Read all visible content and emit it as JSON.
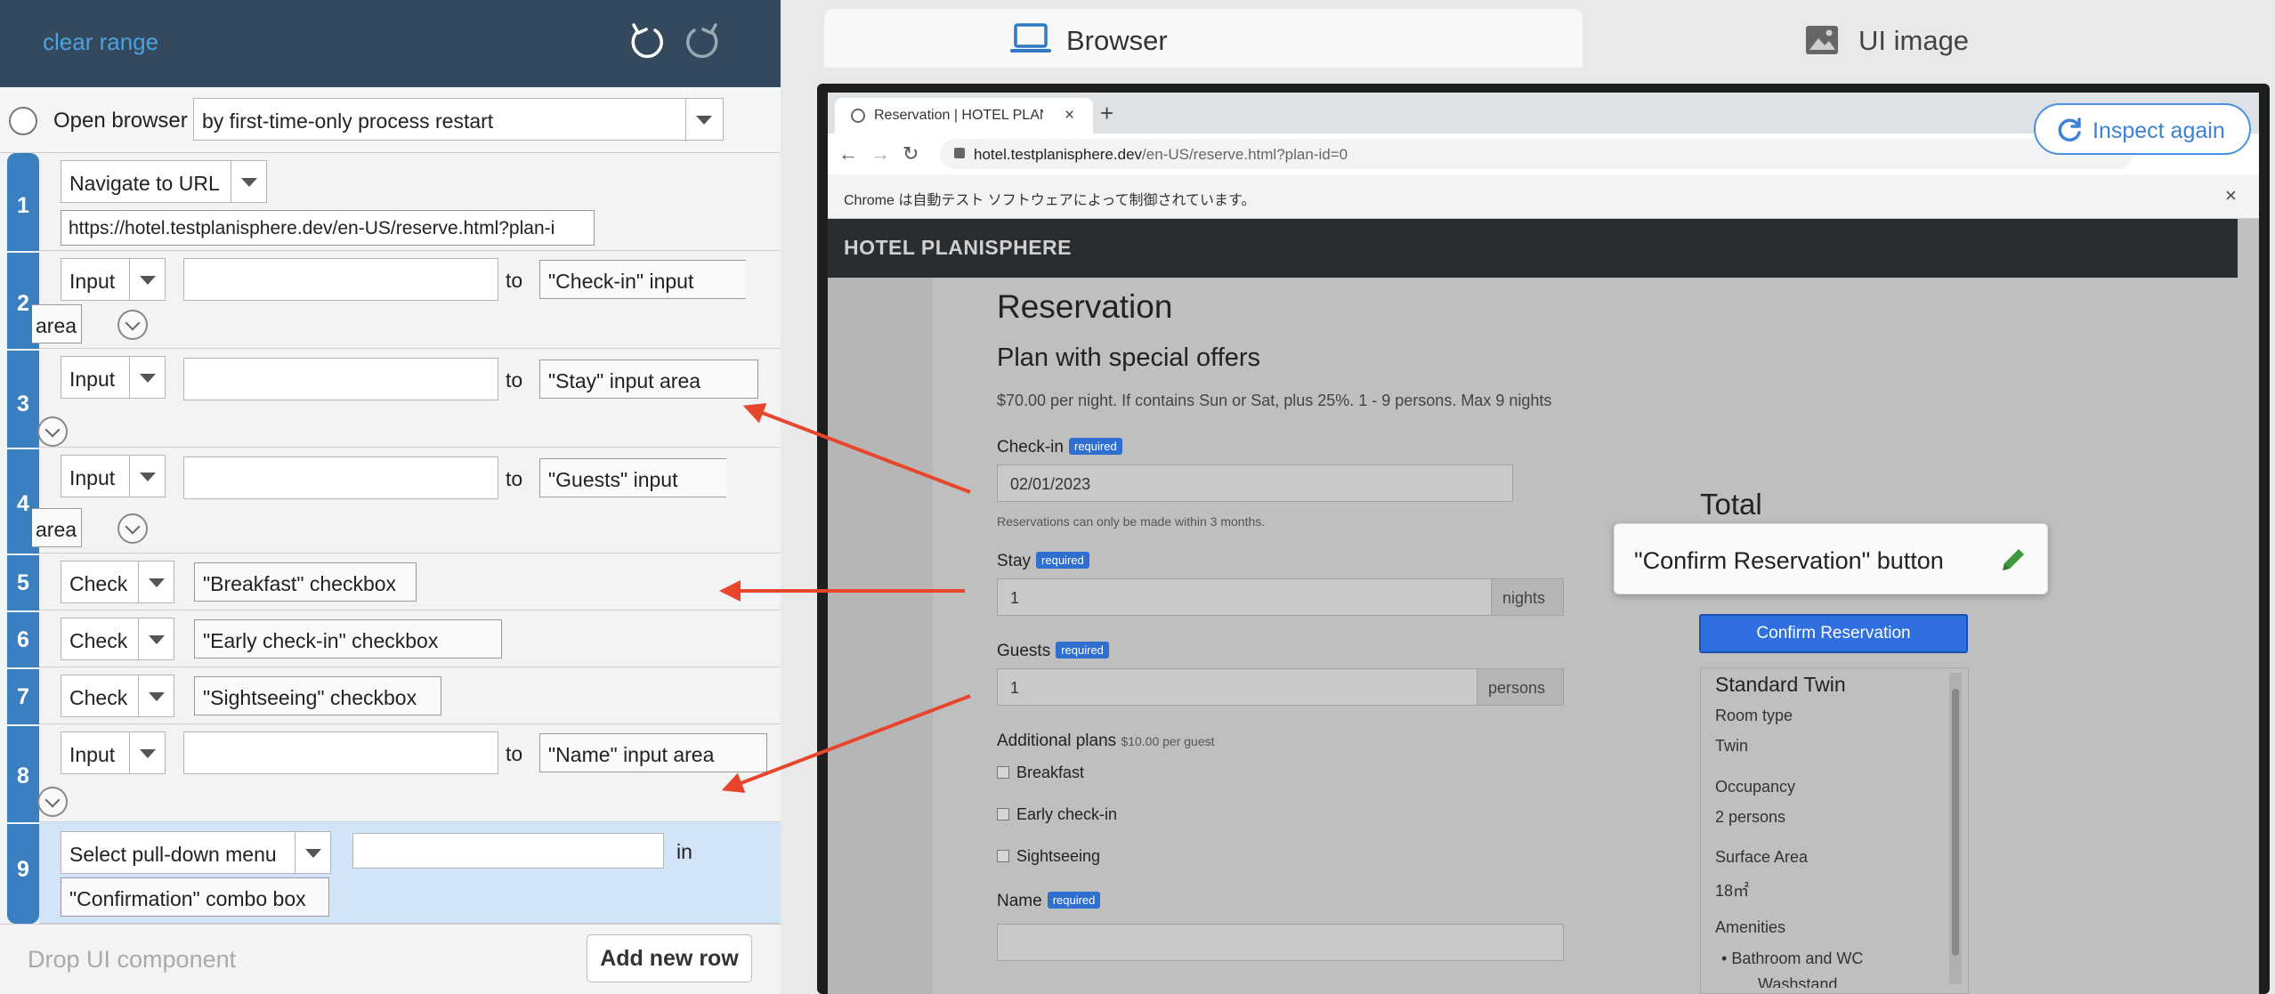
{
  "left_panel": {
    "clear_range": "clear range",
    "open_browser": {
      "label": "Open browser",
      "mode": "by first-time-only process restart"
    },
    "steps": [
      {
        "num": "1",
        "action": "Navigate to URL",
        "url": "https://hotel.testplanisphere.dev/en-US/reserve.html?plan-i"
      },
      {
        "num": "2",
        "action": "Input",
        "connector": "to",
        "target": "\"Check-in\" input",
        "target_wrap": "area"
      },
      {
        "num": "3",
        "action": "Input",
        "connector": "to",
        "target": "\"Stay\" input area"
      },
      {
        "num": "4",
        "action": "Input",
        "connector": "to",
        "target": "\"Guests\" input",
        "target_wrap": "area"
      },
      {
        "num": "5",
        "action": "Check",
        "target": "\"Breakfast\" checkbox"
      },
      {
        "num": "6",
        "action": "Check",
        "target": "\"Early check-in\" checkbox"
      },
      {
        "num": "7",
        "action": "Check",
        "target": "\"Sightseeing\" checkbox"
      },
      {
        "num": "8",
        "action": "Input",
        "connector": "to",
        "target": "\"Name\" input area"
      },
      {
        "num": "9",
        "action": "Select pull-down menu",
        "connector": "in",
        "target": "\"Confirmation\" combo box"
      }
    ],
    "drop_ui": "Drop UI component",
    "add_row": "Add new row"
  },
  "right_panel": {
    "tabs": {
      "browser": "Browser",
      "ui_image": "UI image"
    },
    "inspect_again": "Inspect again",
    "chrome": {
      "tab_title": "Reservation | HOTEL PLANIS",
      "url_host": "hotel.testplanisphere.dev",
      "url_path": "/en-US/reserve.html?plan-id=0",
      "infobar": "Chrome は自動テスト ソフトウェアによって制御されています。"
    },
    "page": {
      "brand": "HOTEL PLANISPHERE",
      "title": "Reservation",
      "plan": "Plan with special offers",
      "desc": "$70.00 per night. If contains Sun or Sat, plus 25%. 1 - 9 persons. Max 9 nights",
      "required": "required",
      "checkin_label": "Check-in",
      "checkin_value": "02/01/2023",
      "checkin_hint": "Reservations can only be made within 3 months.",
      "stay_label": "Stay",
      "stay_value": "1",
      "stay_unit": "nights",
      "guests_label": "Guests",
      "guests_value": "1",
      "guests_unit": "persons",
      "additional_label": "Additional plans",
      "additional_note": "$10.00 per guest",
      "plans": [
        "Breakfast",
        "Early check-in",
        "Sightseeing"
      ],
      "name_label": "Name",
      "total": "Total",
      "confirm": "Confirm Reservation",
      "room": {
        "title": "Standard Twin",
        "room_type_label": "Room type",
        "room_type": "Twin",
        "occupancy_label": "Occupancy",
        "occupancy": "2 persons",
        "area_label": "Surface Area",
        "area": "18㎡",
        "amenities_label": "Amenities",
        "amenity_1": "Bathroom and WC",
        "amenity_2": "Washstand"
      }
    },
    "tooltip": "\"Confirm Reservation\" button"
  },
  "colors": {
    "topbar": "#34495e",
    "rail": "#3a7fbf",
    "accent": "#4a90e2",
    "arrow": "#e8462c",
    "confirm": "#2f6fe0"
  }
}
